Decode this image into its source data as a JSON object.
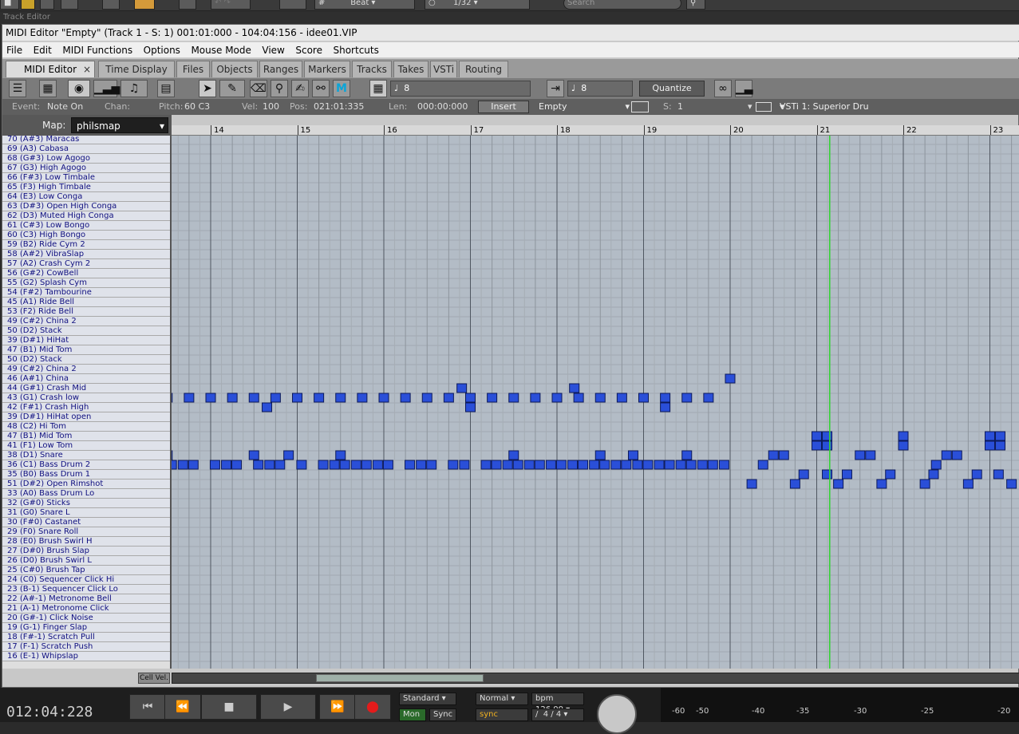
{
  "host": {
    "beat_label": "Beat",
    "grid_value": "1/32",
    "search_placeholder": "Search",
    "track_editor_label": "Track Editor"
  },
  "window": {
    "title": "MIDI Editor \"Empty\"  (Track 1 - S:  1) 001:01:000 - 104:04:156 - idee01.VIP"
  },
  "menu": [
    "File",
    "Edit",
    "MIDI Functions",
    "Options",
    "Mouse Mode",
    "View",
    "Score",
    "Shortcuts"
  ],
  "tabs": [
    {
      "label": "MIDI Editor",
      "active": true
    },
    {
      "label": "Time Display"
    },
    {
      "label": "Files"
    },
    {
      "label": "Objects"
    },
    {
      "label": "Ranges"
    },
    {
      "label": "Markers"
    },
    {
      "label": "Tracks"
    },
    {
      "label": "Takes"
    },
    {
      "label": "VSTi"
    },
    {
      "label": "Routing"
    }
  ],
  "tools": {
    "note_value_1": "8",
    "note_value_2": "8",
    "quantize_label": "Quantize"
  },
  "event": {
    "event_label": "Event:",
    "event_value": "Note On",
    "chan_label": "Chan:",
    "pitch_label": "Pitch:",
    "pitch_value": "60 C3",
    "vel_label": "Vel:",
    "vel_value": "100",
    "pos_label": "Pos:",
    "pos_value": "021:01:335",
    "len_label": "Len:",
    "len_value": "000:00:000",
    "insert_label": "Insert",
    "combo_value": "Empty",
    "s_label": "S:",
    "s_value": "1",
    "vsti_value": "VSTi 1: Superior Dru"
  },
  "map": {
    "label": "Map:",
    "value": "philsmap"
  },
  "ruler_bars": [
    "14",
    "15",
    "16",
    "17",
    "18",
    "19",
    "20",
    "21",
    "22",
    "23"
  ],
  "keys": [
    "70 (A#3) Maracas",
    "69 (A3) Cabasa",
    "68 (G#3) Low Agogo",
    "67 (G3) High Agogo",
    "66 (F#3) Low Timbale",
    "65 (F3) High Timbale",
    "64 (E3) Low Conga",
    "63 (D#3) Open High Conga",
    "62 (D3) Muted High Conga",
    "61 (C#3) Low Bongo",
    "60 (C3) High Bongo",
    "59 (B2) Ride Cym 2",
    "58 (A#2) VibraSlap",
    "57 (A2) Crash Cym 2",
    "56 (G#2) CowBell",
    "55 (G2) Splash Cym",
    "54 (F#2) Tambourine",
    "45 (A1) Ride Bell",
    "53 (F2) Ride Bell",
    "49 (C#2) China 2",
    "50 (D2) Stack",
    "39 (D#1) HiHat",
    "47 (B1) Mid Tom",
    "50 (D2) Stack",
    "49 (C#2) China 2",
    "46 (A#1) China",
    "44 (G#1) Crash Mid",
    "43 (G1) Crash low",
    "42 (F#1) Crash High",
    "39 (D#1) HiHat open",
    "48 (C2) Hi Tom",
    "47 (B1) Mid Tom",
    "41 (F1) Low Tom",
    "38 (D1) Snare",
    "36 (C1) Bass Drum 2",
    "35 (B0) Bass Drum 1",
    "51 (D#2) Open Rimshot",
    "33 (A0) Bass Drum Lo",
    "32 (G#0) Sticks",
    "31 (G0) Snare L",
    "30 (F#0) Castanet",
    "29 (F0) Snare Roll",
    "28 (E0) Brush Swirl H",
    "27 (D#0) Brush Slap",
    "26 (D0) Brush Swirl L",
    "25 (C#0) Brush Tap",
    "24 (C0) Sequencer Click Hi",
    "23 (B-1) Sequencer Click Lo",
    "22 (A#-1) Metronome Bell",
    "21 (A-1) Metronome Click",
    "20 (G#-1) Click Noise",
    "19 (G-1) Finger Slap",
    "18 (F#-1) Scratch Pull",
    "17 (F-1) Scratch Push",
    "16 (E-1) Whipslap"
  ],
  "grid": {
    "first_bar": 13.5,
    "playhead_bar": 21.15,
    "note_color": "#2a4fd8",
    "notes": [
      {
        "row": 25,
        "bars": [
          20.0
        ]
      },
      {
        "row": 26,
        "bars": [
          16.9,
          18.2
        ]
      },
      {
        "row": 27,
        "bars": [
          13.5,
          13.75,
          14.0,
          14.25,
          14.5,
          14.75,
          15.0,
          15.25,
          15.5,
          15.75,
          16.0,
          16.25,
          16.5,
          16.75,
          17.0,
          17.25,
          17.5,
          17.75,
          18.0,
          18.25,
          18.5,
          18.75,
          19.0,
          19.25,
          19.5,
          19.75
        ]
      },
      {
        "row": 28,
        "bars": [
          14.65,
          17.0,
          19.25
        ]
      },
      {
        "row": 31,
        "bars": [
          21.0,
          21.12,
          22.0,
          23.0,
          23.12
        ]
      },
      {
        "row": 32,
        "bars": [
          21.0,
          21.12,
          22.0,
          23.0,
          23.12
        ]
      },
      {
        "row": 33,
        "bars": [
          13.5,
          14.5,
          14.9,
          15.5,
          17.5,
          18.5,
          18.88,
          19.5,
          20.5,
          20.62,
          21.5,
          21.62,
          22.5,
          22.62
        ]
      },
      {
        "row": 34,
        "bars": [
          13.55,
          13.68,
          13.8,
          14.05,
          14.18,
          14.3,
          14.55,
          14.68,
          14.8,
          15.05,
          15.3,
          15.43,
          15.55,
          15.68,
          15.8,
          15.93,
          16.05,
          16.3,
          16.43,
          16.55,
          16.8,
          16.93,
          17.18,
          17.3,
          17.43,
          17.55,
          17.68,
          17.8,
          17.93,
          18.05,
          18.18,
          18.3,
          18.43,
          18.55,
          18.68,
          18.8,
          18.93,
          19.05,
          19.18,
          19.3,
          19.43,
          19.55,
          19.68,
          19.8,
          19.93,
          20.38,
          22.38
        ]
      },
      {
        "row": 35,
        "bars": [
          20.85,
          21.12,
          21.35,
          21.85,
          22.35,
          22.85,
          23.1
        ]
      },
      {
        "row": 36,
        "bars": [
          20.25,
          20.75,
          21.25,
          21.75,
          22.25,
          22.75,
          23.25
        ]
      }
    ]
  },
  "bottom": {
    "cell_vel_label": "Cell Vel."
  },
  "transport": {
    "time": "012:04:228",
    "mode": "Standard",
    "mode2": "Normal",
    "bpm_label": "bpm",
    "bpm_value": "126.00",
    "mon_label": "Mon",
    "sync_label": "Sync",
    "sync2_label": "sync",
    "signature": "4 / 4",
    "meter_ticks": [
      "-60",
      "-50",
      "-40",
      "-35",
      "-30",
      "-25",
      "-20"
    ]
  }
}
